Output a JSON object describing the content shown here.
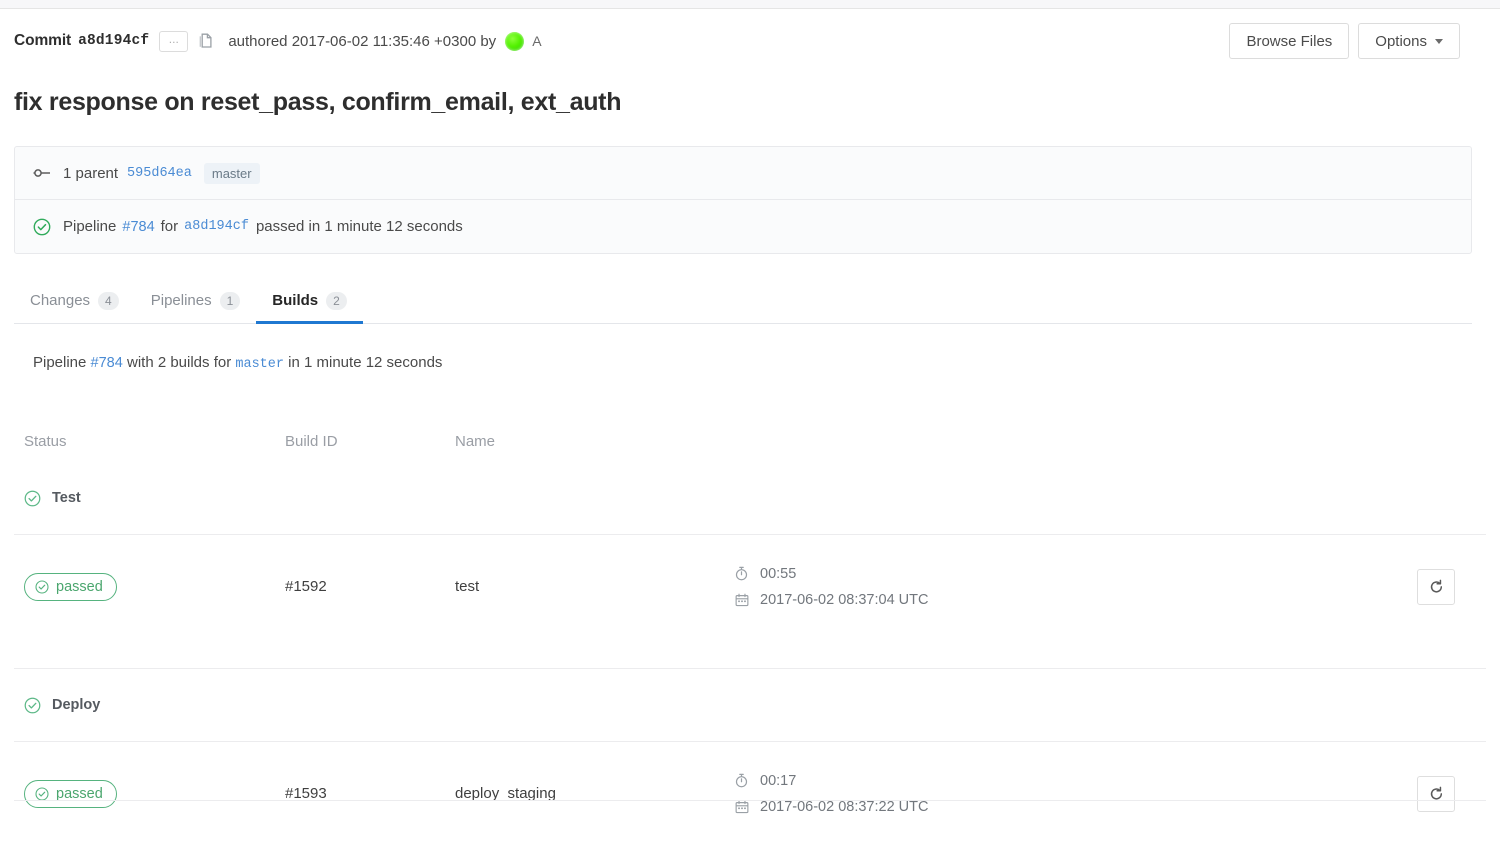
{
  "header": {
    "commit_label": "Commit",
    "commit_sha": "a8d194cf",
    "ellipsis_label": "...",
    "copy_icon": "copy-icon",
    "authored_text": "authored 2017-06-02 11:35:46 +0300 by",
    "author_name": "A",
    "browse_files_label": "Browse Files",
    "options_label": "Options"
  },
  "commit": {
    "title": "fix response on reset_pass, confirm_email, ext_auth"
  },
  "info_panel": {
    "parent_count_text": "1 parent",
    "parent_sha": "595d64ea",
    "branch_badge": "master",
    "pipeline_prefix": "Pipeline",
    "pipeline_id": "#784",
    "pipeline_for": "for",
    "pipeline_commit_sha": "a8d194cf",
    "pipeline_result": "passed in 1 minute 12 seconds"
  },
  "tabs": [
    {
      "label": "Changes",
      "count": "4",
      "active": false
    },
    {
      "label": "Pipelines",
      "count": "1",
      "active": false
    },
    {
      "label": "Builds",
      "count": "2",
      "active": true
    }
  ],
  "pipeline_summary": {
    "prefix": "Pipeline",
    "id": "#784",
    "middle": "with 2 builds for",
    "branch": "master",
    "suffix": "in 1 minute 12 seconds"
  },
  "builds_table": {
    "columns": {
      "status": "Status",
      "build_id": "Build ID",
      "name": "Name"
    },
    "stages": [
      {
        "stage_name": "Test",
        "stage_status_icon": "check-circle-icon",
        "builds": [
          {
            "status_label": "passed",
            "build_id": "#1592",
            "name": "test",
            "duration": "00:55",
            "finished_at": "2017-06-02 08:37:04 UTC",
            "retry_icon": "retry-icon"
          }
        ]
      },
      {
        "stage_name": "Deploy",
        "stage_status_icon": "check-circle-icon",
        "builds": [
          {
            "status_label": "passed",
            "build_id": "#1593",
            "name": "deploy_staging",
            "duration": "00:17",
            "finished_at": "2017-06-02 08:37:22 UTC",
            "retry_icon": "retry-icon"
          }
        ]
      }
    ]
  },
  "colors": {
    "success_green": "#4ba66e",
    "link_blue": "#4a8bd4",
    "active_tab_blue": "#1f78d1",
    "avatar_green": "#54f202"
  }
}
